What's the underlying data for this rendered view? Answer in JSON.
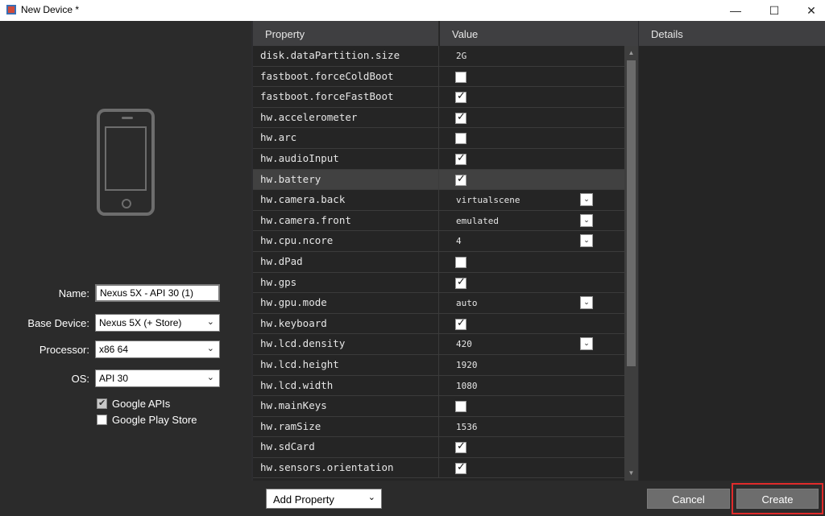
{
  "window": {
    "title": "New Device *",
    "minimize": "—",
    "maximize": "☐",
    "close": "✕"
  },
  "form": {
    "name_label": "Name:",
    "name_value": "Nexus 5X - API 30 (1)",
    "base_device_label": "Base Device:",
    "base_device_value": "Nexus 5X (+ Store)",
    "processor_label": "Processor:",
    "processor_value": "x86 64",
    "os_label": "OS:",
    "os_value": "API 30",
    "google_apis_label": "Google APIs",
    "google_apis_checked": true,
    "google_play_label": "Google Play Store",
    "google_play_checked": false
  },
  "grid": {
    "headers": {
      "property": "Property",
      "value": "Value",
      "details": "Details"
    },
    "rows": [
      {
        "prop": "disk.dataPartition.size",
        "value": "2G"
      },
      {
        "prop": "fastboot.forceColdBoot",
        "check": false
      },
      {
        "prop": "fastboot.forceFastBoot",
        "check": true
      },
      {
        "prop": "hw.accelerometer",
        "check": true
      },
      {
        "prop": "hw.arc",
        "check": false
      },
      {
        "prop": "hw.audioInput",
        "check": true
      },
      {
        "prop": "hw.battery",
        "check": true,
        "selected": true
      },
      {
        "prop": "hw.camera.back",
        "value": "virtualscene",
        "dropdown": true
      },
      {
        "prop": "hw.camera.front",
        "value": "emulated",
        "dropdown": true
      },
      {
        "prop": "hw.cpu.ncore",
        "value": "4",
        "dropdown": true
      },
      {
        "prop": "hw.dPad",
        "check": false
      },
      {
        "prop": "hw.gps",
        "check": true
      },
      {
        "prop": "hw.gpu.mode",
        "value": "auto",
        "dropdown": true
      },
      {
        "prop": "hw.keyboard",
        "check": true
      },
      {
        "prop": "hw.lcd.density",
        "value": "420",
        "dropdown": true
      },
      {
        "prop": "hw.lcd.height",
        "value": "1920"
      },
      {
        "prop": "hw.lcd.width",
        "value": "1080"
      },
      {
        "prop": "hw.mainKeys",
        "check": false
      },
      {
        "prop": "hw.ramSize",
        "value": "1536"
      },
      {
        "prop": "hw.sdCard",
        "check": true
      },
      {
        "prop": "hw.sensors.orientation",
        "check": true
      }
    ]
  },
  "footer": {
    "add_property": "Add Property",
    "cancel": "Cancel",
    "create": "Create"
  },
  "colors": {
    "background": "#2d2d30",
    "header": "#3f3f41",
    "highlight_outline": "#e02b2b"
  }
}
